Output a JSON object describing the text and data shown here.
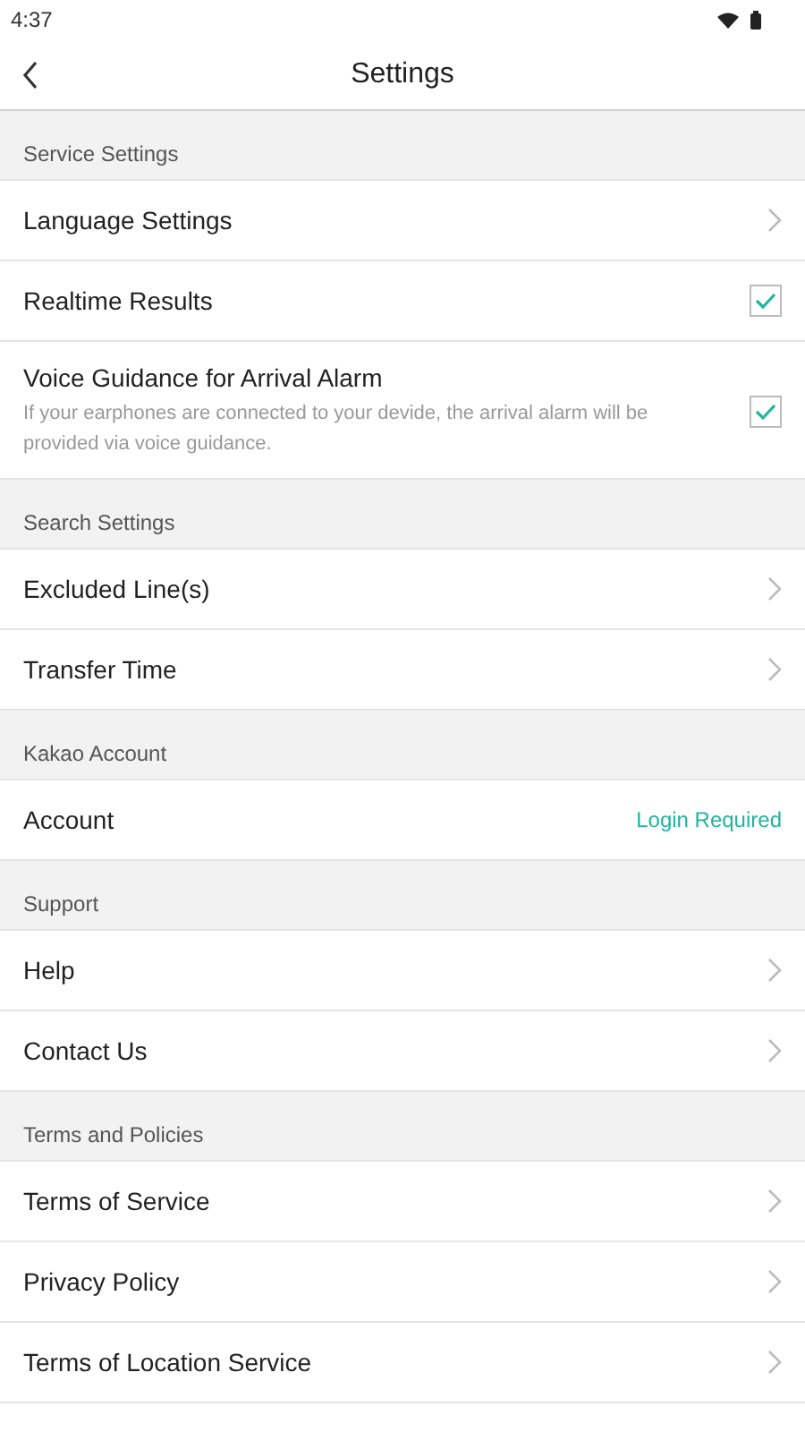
{
  "status_bar": {
    "time": "4:37"
  },
  "app_bar": {
    "title": "Settings"
  },
  "sections": [
    {
      "title": "Service Settings",
      "rows": [
        {
          "kind": "link",
          "label": "Language Settings"
        },
        {
          "kind": "checkbox",
          "label": "Realtime Results",
          "checked": true
        },
        {
          "kind": "checkbox",
          "label": "Voice Guidance for Arrival Alarm",
          "description": "If your earphones are connected to your devide, the arrival alarm will be provided via voice guidance.",
          "checked": true
        }
      ]
    },
    {
      "title": "Search Settings",
      "rows": [
        {
          "kind": "link",
          "label": "Excluded Line(s)"
        },
        {
          "kind": "link",
          "label": "Transfer Time"
        }
      ]
    },
    {
      "title": "Kakao Account",
      "rows": [
        {
          "kind": "value",
          "label": "Account",
          "value": "Login Required"
        }
      ]
    },
    {
      "title": "Support",
      "rows": [
        {
          "kind": "link",
          "label": "Help"
        },
        {
          "kind": "link",
          "label": "Contact Us"
        }
      ]
    },
    {
      "title": "Terms and Policies",
      "rows": [
        {
          "kind": "link",
          "label": "Terms of Service"
        },
        {
          "kind": "link",
          "label": "Privacy Policy"
        },
        {
          "kind": "link",
          "label": "Terms of Location Service"
        }
      ]
    }
  ]
}
